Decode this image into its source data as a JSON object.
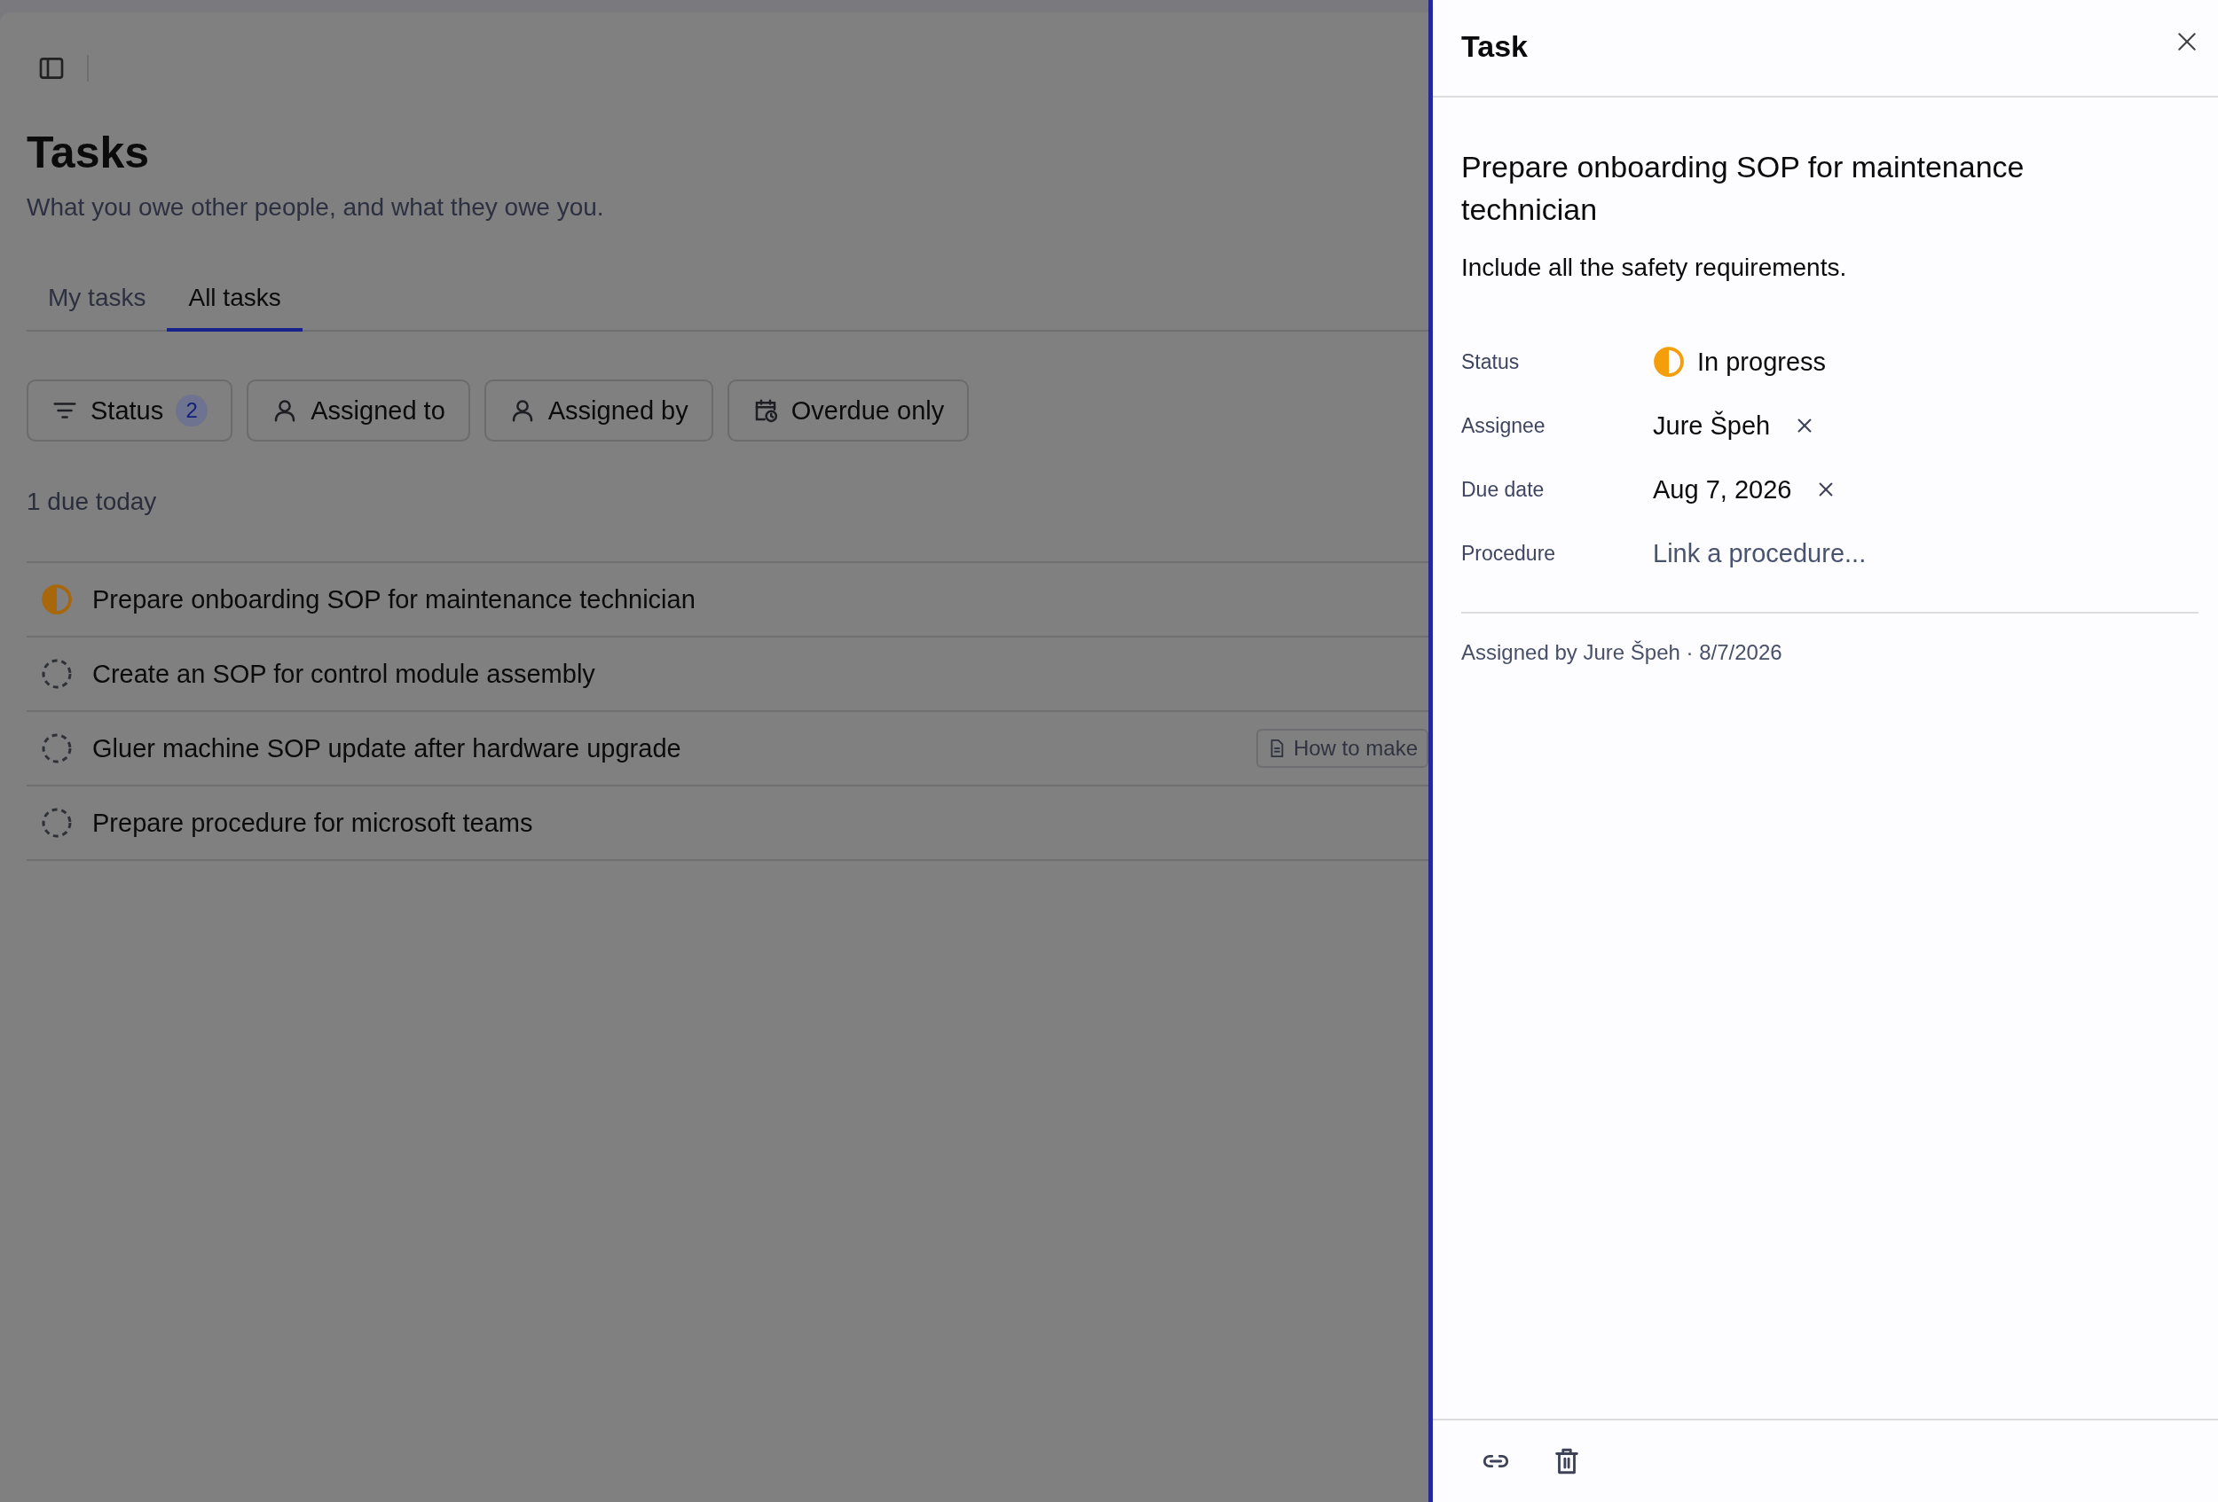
{
  "page": {
    "title": "Tasks",
    "subtitle": "What you owe other people, and what they owe you."
  },
  "tabs": [
    {
      "label": "My tasks",
      "selected": false
    },
    {
      "label": "All tasks",
      "selected": true
    }
  ],
  "filters": [
    {
      "kind": "status",
      "label": "Status",
      "count": "2"
    },
    {
      "kind": "person",
      "label": "Assigned to"
    },
    {
      "kind": "person",
      "label": "Assigned by"
    },
    {
      "kind": "calendar",
      "label": "Overdue only"
    }
  ],
  "due_summary": "1 due today",
  "tasks": [
    {
      "title": "Prepare onboarding SOP for maintenance technician",
      "started": true
    },
    {
      "title": "Create an SOP for control module assembly",
      "started": false
    },
    {
      "title": "Gluer machine SOP update after hardware upgrade",
      "started": false,
      "procedure": "How to make"
    },
    {
      "title": "Prepare procedure for microsoft teams",
      "started": false
    }
  ],
  "panel": {
    "title": "Task",
    "task_title": "Prepare onboarding SOP for maintenance technician",
    "description": "Include all the safety requirements.",
    "fields": [
      {
        "kind": "status",
        "label": "Status",
        "value": "In progress",
        "started": true
      },
      {
        "kind": "removable",
        "label": "Assignee",
        "value": "Jure Špeh"
      },
      {
        "kind": "removable",
        "label": "Due date",
        "value": "Aug 7, 2026"
      },
      {
        "kind": "link",
        "label": "Procedure",
        "value": "Link a procedure..."
      }
    ],
    "assigned_info": "Assigned by Jure Špeh · 8/7/2026"
  }
}
